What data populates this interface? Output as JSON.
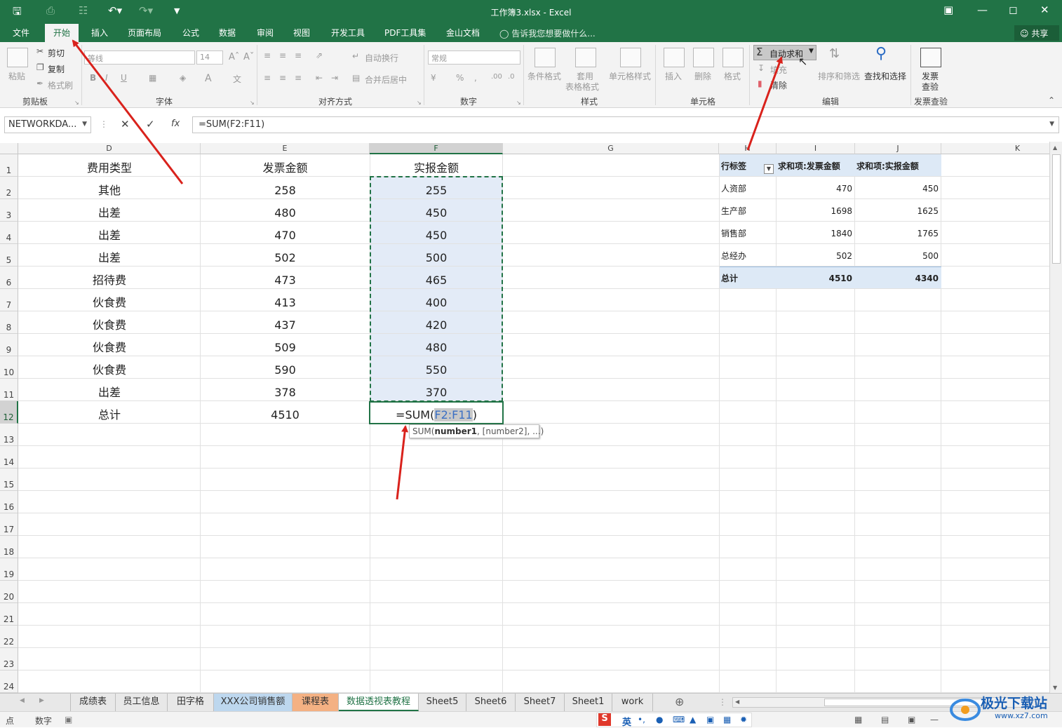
{
  "window": {
    "title": "工作簿3.xlsx - Excel"
  },
  "menu": {
    "file": "文件",
    "home": "开始",
    "insert": "插入",
    "page_layout": "页面布局",
    "formulas": "公式",
    "data": "数据",
    "review": "审阅",
    "view": "视图",
    "developer": "开发工具",
    "pdf": "PDF工具集",
    "kingsoft": "金山文档",
    "tell_me": "告诉我您想要做什么...",
    "share": "共享"
  },
  "ribbon": {
    "clipboard": {
      "paste": "粘贴",
      "cut": "剪切",
      "copy": "复制",
      "format_painter": "格式刷",
      "label": "剪贴板"
    },
    "font": {
      "name": "等线",
      "size": "14",
      "label": "字体"
    },
    "alignment": {
      "wrap": "自动换行",
      "merge": "合并后居中",
      "label": "对齐方式"
    },
    "number": {
      "format": "常规",
      "label": "数字"
    },
    "styles": {
      "conditional": "条件格式",
      "table1": "套用",
      "table2": "表格格式",
      "cell_styles": "单元格样式",
      "label": "样式"
    },
    "cells": {
      "insert": "插入",
      "delete": "删除",
      "format": "格式",
      "label": "单元格"
    },
    "editing": {
      "autosum": "自动求和",
      "fill": "填充",
      "clear": "清除",
      "sort": "排序和筛选",
      "find": "查找和选择",
      "label": "编辑"
    },
    "invoice": {
      "line1": "发票",
      "line2": "查验",
      "label": "发票查验"
    }
  },
  "formula_bar": {
    "name_box": "NETWORKDA...",
    "formula": "=SUM(F2:F11)"
  },
  "columns": [
    "D",
    "E",
    "F",
    "G",
    "H",
    "I",
    "J",
    "K"
  ],
  "rows": [
    "1",
    "2",
    "3",
    "4",
    "5",
    "6",
    "7",
    "8",
    "9",
    "10",
    "11",
    "12",
    "13",
    "14",
    "15",
    "16",
    "17",
    "18",
    "19",
    "20",
    "21",
    "22",
    "23",
    "24"
  ],
  "table": {
    "headers": [
      "费用类型",
      "发票金额",
      "实报金额"
    ],
    "rows": [
      [
        "其他",
        "258",
        "255"
      ],
      [
        "出差",
        "480",
        "450"
      ],
      [
        "出差",
        "470",
        "450"
      ],
      [
        "出差",
        "502",
        "500"
      ],
      [
        "招待费",
        "473",
        "465"
      ],
      [
        "伙食费",
        "413",
        "400"
      ],
      [
        "伙食费",
        "437",
        "420"
      ],
      [
        "伙食费",
        "509",
        "480"
      ],
      [
        "伙食费",
        "590",
        "550"
      ],
      [
        "出差",
        "378",
        "370"
      ]
    ],
    "total_label": "总计",
    "total_invoice": "4510",
    "editing_prefix": "=SUM(",
    "editing_range": "F2:F11",
    "editing_suffix": ")",
    "tooltip_fn": "SUM(",
    "tooltip_arg1": "number1",
    "tooltip_rest": ", [number2], ...)"
  },
  "pivot": {
    "headers": [
      "行标签",
      "求和项:发票金额",
      "求和项:实报金额"
    ],
    "rows": [
      [
        "人资部",
        "470",
        "450"
      ],
      [
        "生产部",
        "1698",
        "1625"
      ],
      [
        "销售部",
        "1840",
        "1765"
      ],
      [
        "总经办",
        "502",
        "500"
      ]
    ],
    "total": [
      "总计",
      "4510",
      "4340"
    ]
  },
  "sheets": [
    "成绩表",
    "员工信息",
    "田字格",
    "XXX公司销售额",
    "课程表",
    "数据透视表教程",
    "Sheet5",
    "Sheet6",
    "Sheet7",
    "Sheet1",
    "work"
  ],
  "status": {
    "mode": "点",
    "num": "数字"
  },
  "watermark": {
    "brand": "极光下载站",
    "url": "www.xz7.com"
  },
  "colors": {
    "excel_green": "#217346",
    "arrow": "#d9221c",
    "selection": "#e3ebf7",
    "tab_blue": "#bdd7ee",
    "tab_orange": "#f4b183"
  }
}
